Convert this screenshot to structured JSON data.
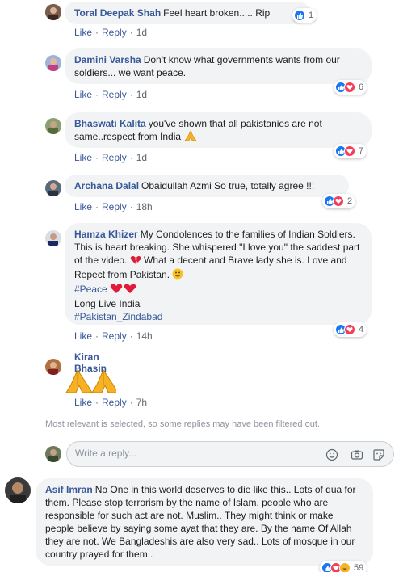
{
  "comments": [
    {
      "name": "Toral Deepak Shah",
      "text": "Feel heart broken..... Rip",
      "like": "Like",
      "reply": "Reply",
      "time": "1d",
      "reactions": "1"
    },
    {
      "name": "Damini Varsha",
      "text": "Don't know what governments wants from our soldiers... we want peace.",
      "like": "Like",
      "reply": "Reply",
      "time": "1d",
      "reactions": "6"
    },
    {
      "name": "Bhaswati Kalita",
      "text": "you've shown that all pakistanies are not same..respect from India",
      "like": "Like",
      "reply": "Reply",
      "time": "1d",
      "reactions": "7"
    },
    {
      "name": "Archana Dalal",
      "text": "Obaidullah Azmi So true, totally agree !!!",
      "like": "Like",
      "reply": "Reply",
      "time": "18h",
      "reactions": "2"
    },
    {
      "name": "Hamza Khizer",
      "text": "My Condolences to the families of Indian Soldiers. This is heart breaking. She whispered \"I love you\" the saddest part of the video.",
      "text2": "What a decent and Brave lady she is. Love and Repect from Pakistan.",
      "tag1": "#Peace",
      "line_long": "Long Live India",
      "tag2": "#Pakistan_Zindabad",
      "like": "Like",
      "reply": "Reply",
      "time": "14h",
      "reactions": "4"
    },
    {
      "name": "Kiran Bhasin",
      "like": "Like",
      "reply": "Reply",
      "time": "7h"
    }
  ],
  "notice": "Most relevant is selected, so some replies may have been filtered out.",
  "reply_box": {
    "placeholder": "Write a reply..."
  },
  "main_comment": {
    "name": "Asif Imran",
    "text": "No One in this world deserves to die like this.. Lots of dua for them. Please stop terrorism by the name of Islam. people who are responsible for such act are not. Muslim.. They might think or make people believe by saying some ayat that they are. By the name Of Allah they are not. We Bangladeshis are also very sad.. Lots of mosque in our country prayed for them..",
    "reactions": "59"
  },
  "colors": {
    "link": "#385898",
    "bubble": "#f2f3f5",
    "like": "#1877f2",
    "love": "#f33e58",
    "haha": "#f7b125"
  }
}
